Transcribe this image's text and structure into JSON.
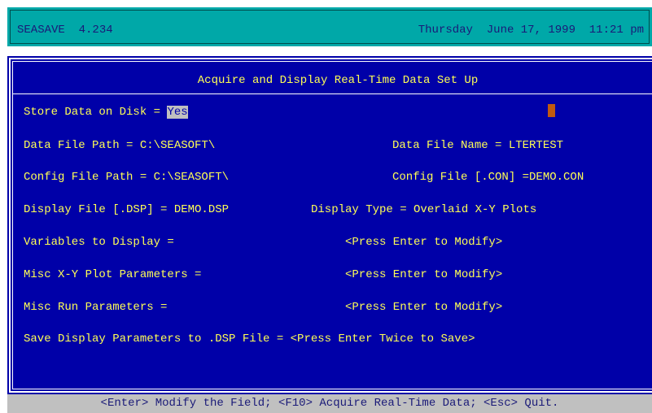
{
  "title_bar": {
    "app_name": "SEASAVE  4.234",
    "datetime": "Thursday  June 17, 1999  11:21 pm"
  },
  "panel": {
    "title": "Acquire and Display Real-Time Data Set Up",
    "store_label": "Store Data on Disk = ",
    "store_value": "Yes",
    "data_file_path": "Data File Path = C:\\SEASOFT\\",
    "data_file_name": "Data File Name = LTERTEST",
    "config_file_path": "Config File Path = C:\\SEASOFT\\",
    "config_file": "Config File [.CON] =DEMO.CON",
    "display_file": "Display File [.DSP] = DEMO.DSP",
    "display_type": "Display Type = Overlaid X-Y Plots",
    "variables_label": "Variables to Display =",
    "variables_value": "<Press Enter to Modify>",
    "misc_xy_label": "Misc X-Y Plot Parameters =",
    "misc_xy_value": "<Press Enter to Modify>",
    "misc_run_label": "Misc Run Parameters =",
    "misc_run_value": "<Press Enter to Modify>",
    "save_display_label": "Save Display Parameters to .DSP File = ",
    "save_display_value": "<Press Enter Twice to Save>"
  },
  "status_bar": {
    "text": "<Enter> Modify the Field; <F10> Acquire Real-Time Data; <Esc> Quit."
  },
  "colors": {
    "background": "#0000a8",
    "text": "#ffff55",
    "title_bar": "#00a8a8",
    "status_bar": "#c0c0c0",
    "cursor": "#c05a10"
  }
}
